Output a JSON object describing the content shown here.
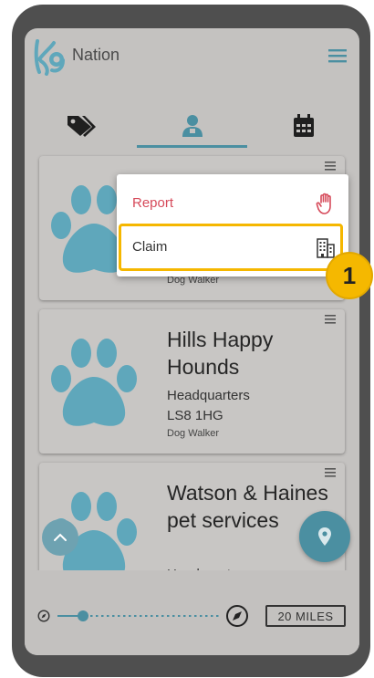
{
  "header": {
    "brand": "Nation"
  },
  "tabs": [
    {
      "id": "deals",
      "icon": "tags-icon"
    },
    {
      "id": "profile",
      "icon": "user-icon",
      "active": true
    },
    {
      "id": "calendar",
      "icon": "calendar-icon"
    }
  ],
  "listings": [
    {
      "name": "",
      "location": "",
      "postcode": "",
      "category": "Dog Walker"
    },
    {
      "name": "Hills Happy Hounds",
      "location": "Headquarters",
      "postcode": "LS8 1HG",
      "category": "Dog Walker"
    },
    {
      "name": "Watson & Haines pet services",
      "location": "Headquarters"
    }
  ],
  "popover": {
    "items": [
      {
        "label": "Report",
        "icon": "hand-icon",
        "color": "#d64a5a"
      },
      {
        "label": "Claim",
        "icon": "building-icon",
        "color": "#333333"
      }
    ]
  },
  "annotation": {
    "step": "1"
  },
  "bottom": {
    "distance_label": "20 MILES",
    "distance_value": 20
  },
  "colors": {
    "accent": "#4b8fa1",
    "highlight": "#f5b700",
    "report": "#d64a5a"
  }
}
